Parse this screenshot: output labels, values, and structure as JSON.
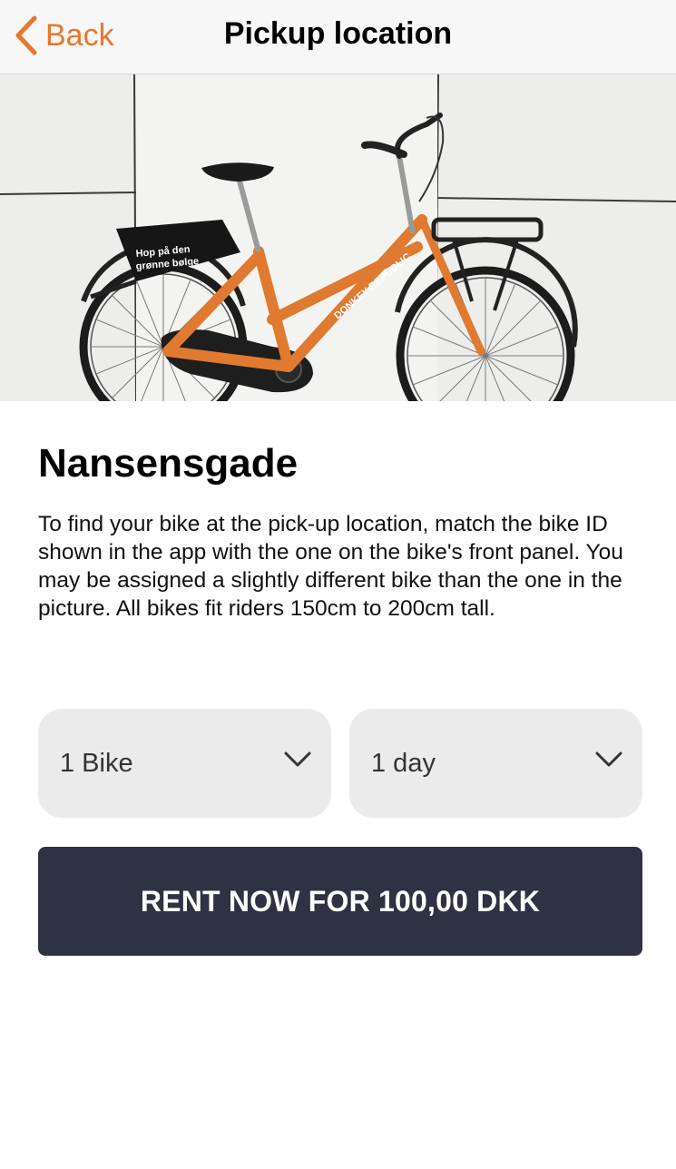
{
  "nav": {
    "back_label": "Back",
    "title": "Pickup location"
  },
  "hero": {
    "alt": "Orange Donkey Republic bike against a white tiled wall",
    "frame_brand": "DONKEY REPUBLIC",
    "box_line1": "Hop på den",
    "box_line2": "grønne bølge",
    "bike_color": "#e07a30"
  },
  "location": {
    "name": "Nansensgade",
    "description": "To find your bike at the pick-up location, match the bike ID shown in the app with the one on the bike's front panel. You may be assigned a slightly different bike than the one in the picture. All bikes fit riders 150cm to 200cm tall."
  },
  "options": {
    "bikes_value": "1 Bike",
    "duration_value": "1 day"
  },
  "cta": {
    "label": "RENT NOW FOR 100,00 DKK"
  },
  "colors": {
    "accent": "#e8772e",
    "cta_bg": "#2f3242",
    "select_bg": "#ebebeb"
  }
}
